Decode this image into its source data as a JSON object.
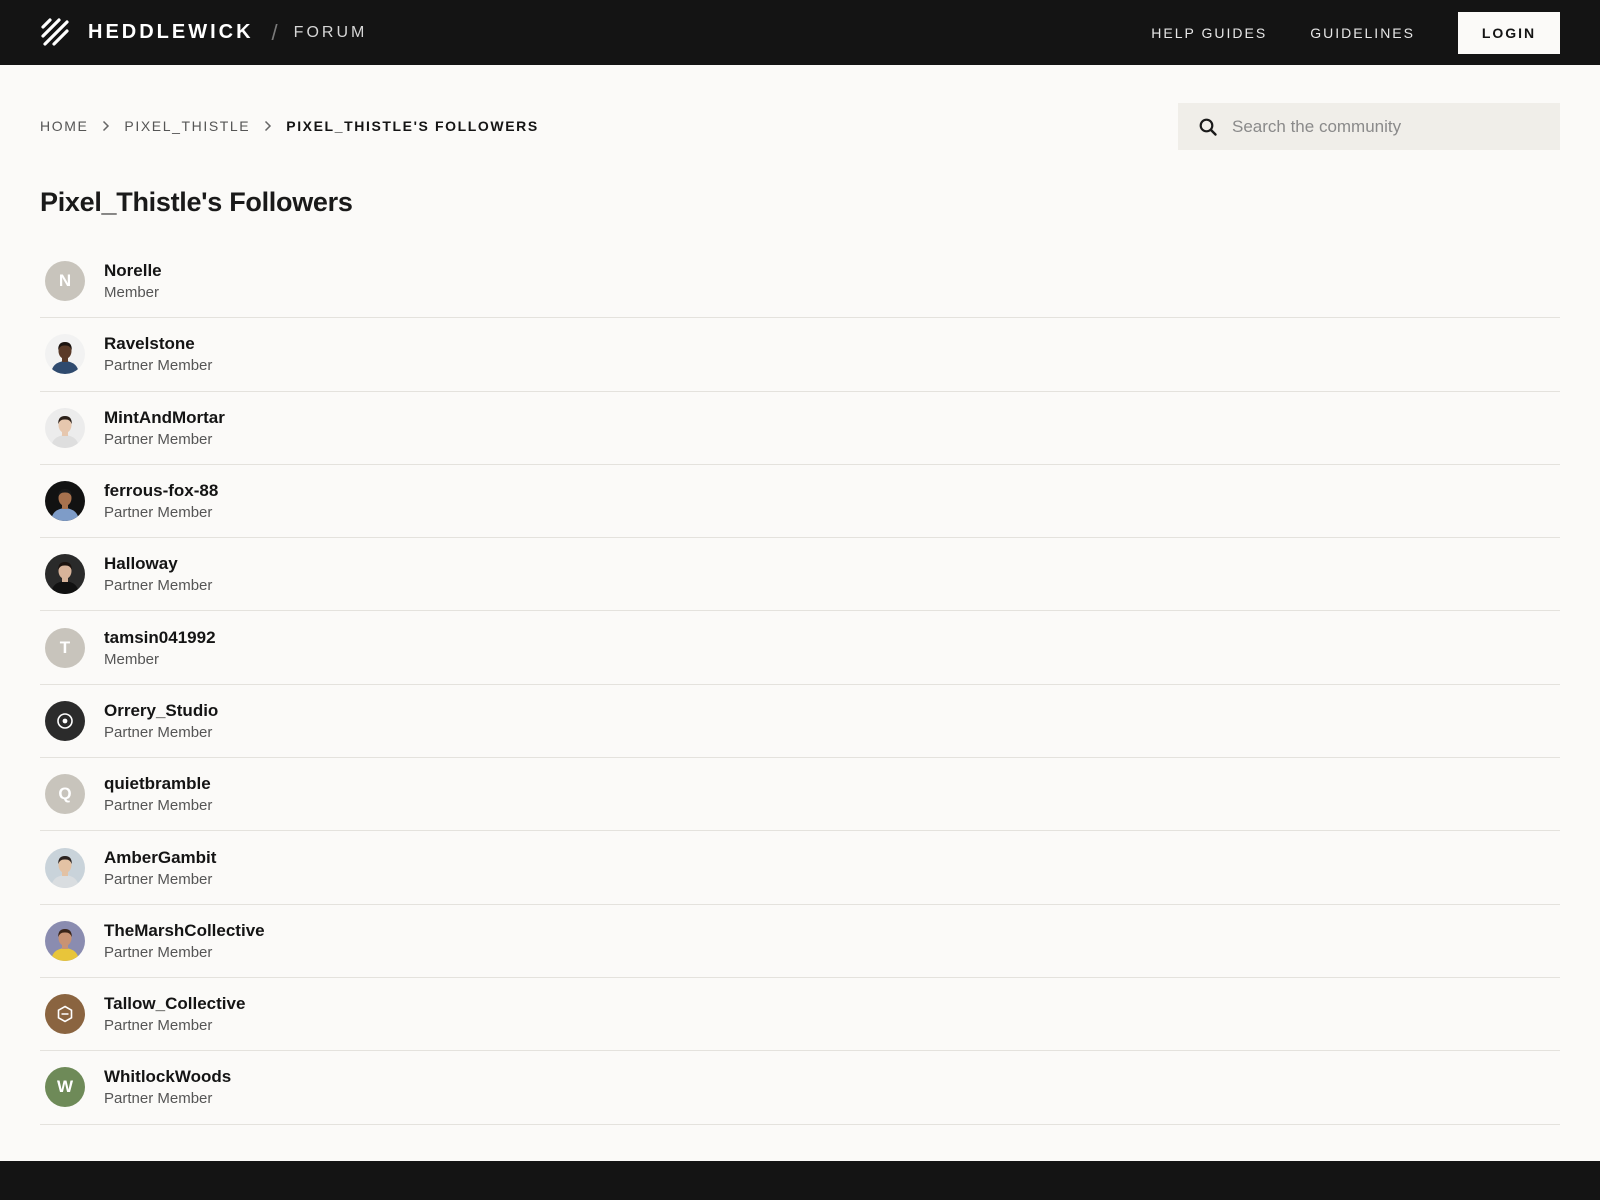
{
  "header": {
    "brand": "HEDDLEWICK",
    "separator": "/",
    "section": "FORUM",
    "nav": [
      {
        "label": "HELP GUIDES"
      },
      {
        "label": "GUIDELINES"
      }
    ],
    "login_label": "LOGIN"
  },
  "breadcrumb": {
    "items": [
      {
        "label": "HOME"
      },
      {
        "label": "PIXEL_THISTLE"
      },
      {
        "label": "PIXEL_THISTLE'S FOLLOWERS"
      }
    ]
  },
  "search": {
    "placeholder": "Search the community",
    "value": ""
  },
  "page": {
    "title": "Pixel_Thistle's Followers"
  },
  "followers": [
    {
      "name": "Norelle",
      "role": "Member",
      "avatar": {
        "kind": "initial",
        "text": "N",
        "color": "#c8c4bc"
      }
    },
    {
      "name": "Ravelstone",
      "role": "Partner Member",
      "avatar": {
        "kind": "photo",
        "bg": "#f2f2f2",
        "skin": "#5a3a28",
        "hair": "#1c1410",
        "shirt": "#2f4a6e"
      }
    },
    {
      "name": "MintAndMortar",
      "role": "Partner Member",
      "avatar": {
        "kind": "photo",
        "bg": "#ececec",
        "skin": "#e6c7ae",
        "hair": "#2a1f18",
        "shirt": "#dedede"
      }
    },
    {
      "name": "ferrous-fox-88",
      "role": "Partner Member",
      "avatar": {
        "kind": "photo",
        "bg": "#121212",
        "skin": "#a8724e",
        "hair": "#1a1a1a",
        "shirt": "#7e9cc8"
      }
    },
    {
      "name": "Halloway",
      "role": "Partner Member",
      "avatar": {
        "kind": "photo",
        "bg": "#2a2a2a",
        "skin": "#d7b39a",
        "hair": "#1b120e",
        "shirt": "#111111"
      }
    },
    {
      "name": "tamsin041992",
      "role": "Member",
      "avatar": {
        "kind": "initial",
        "text": "T",
        "color": "#c8c4bc"
      }
    },
    {
      "name": "Orrery_Studio",
      "role": "Partner Member",
      "avatar": {
        "kind": "logo",
        "icon": "orrery-ring-icon",
        "color": "#2b2b2b"
      }
    },
    {
      "name": "quietbramble",
      "role": "Partner Member",
      "avatar": {
        "kind": "initial",
        "text": "Q",
        "color": "#c8c4bc"
      }
    },
    {
      "name": "AmberGambit",
      "role": "Partner Member",
      "avatar": {
        "kind": "photo",
        "bg": "#c9d3da",
        "skin": "#e3c2a4",
        "hair": "#2b2320",
        "shirt": "#d9dde0"
      }
    },
    {
      "name": "TheMarshCollective",
      "role": "Partner Member",
      "avatar": {
        "kind": "photo",
        "bg": "#8a8cb0",
        "skin": "#c99373",
        "hair": "#3a2418",
        "shirt": "#e8c53a"
      }
    },
    {
      "name": "Tallow_Collective",
      "role": "Partner Member",
      "avatar": {
        "kind": "logo",
        "icon": "hexagon-icon",
        "color": "#8a6440"
      }
    },
    {
      "name": "WhitlockWoods",
      "role": "Partner Member",
      "avatar": {
        "kind": "initial",
        "text": "W",
        "color": "#6e8a58"
      }
    }
  ]
}
